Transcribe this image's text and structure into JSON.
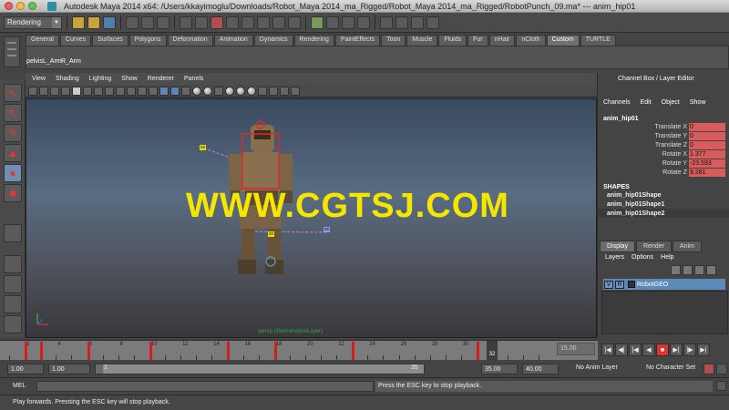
{
  "window": {
    "title": "Autodesk Maya 2014 x64: /Users/kkayimoglu/Downloads/Robot_Maya 2014_ma_Rigged/Robot_Maya 2014_ma_Rigged/RobotPunch_09.ma*   ---   anim_hip01",
    "traffic_colors": [
      "#ee5c55",
      "#f6bc3a",
      "#5ec749"
    ]
  },
  "status_line": {
    "menu_set": "Rendering"
  },
  "shelf": {
    "tabs": [
      "General",
      "Curves",
      "Surfaces",
      "Polygons",
      "Deformation",
      "Animation",
      "Dynamics",
      "Rendering",
      "PaintEffects",
      "Toon",
      "Muscle",
      "Fluids",
      "Fur",
      "nHair",
      "nCloth",
      "Custom",
      "TURTLE"
    ],
    "active_tab": "Custom",
    "items": [
      "pelvis",
      "L_Arm",
      "R_Arm"
    ]
  },
  "panel": {
    "menus": [
      "View",
      "Shading",
      "Lighting",
      "Show",
      "Renderer",
      "Panels"
    ],
    "camera_label": "persp (lifeAnimationLayer)",
    "watermark": "WWW.CGTSJ.COM",
    "control_tags": [
      "xx",
      "xx",
      "xx"
    ]
  },
  "channel_box": {
    "title": "Channel Box / Layer Editor",
    "menus": [
      "Channels",
      "Edit",
      "Object",
      "Show"
    ],
    "object": "anim_hip01",
    "attributes": [
      {
        "name": "Translate X",
        "value": "0"
      },
      {
        "name": "Translate Y",
        "value": "0"
      },
      {
        "name": "Translate Z",
        "value": "0"
      },
      {
        "name": "Rotate X",
        "value": "1.377"
      },
      {
        "name": "Rotate Y",
        "value": "-23.593"
      },
      {
        "name": "Rotate Z",
        "value": "9.281"
      }
    ],
    "shapes_header": "SHAPES",
    "shapes": [
      "anim_hip01Shape",
      "anim_hip01Shape1",
      "anim_hip01Shape2"
    ]
  },
  "layer_editor": {
    "tabs": [
      "Display",
      "Render",
      "Anim"
    ],
    "active_tab": "Display",
    "menus": [
      "Layers",
      "Options",
      "Help"
    ],
    "layers": [
      {
        "v": "V",
        "r": "R",
        "name": "RobotGEO"
      }
    ]
  },
  "time_slider": {
    "tick_labels": [
      "2",
      "4",
      "6",
      "8",
      "10",
      "12",
      "14",
      "16",
      "18",
      "20",
      "22",
      "24",
      "26",
      "28",
      "30"
    ],
    "current_frame": "32",
    "end_field": "15.00",
    "keyframes": [
      2,
      3,
      6,
      10,
      15,
      18,
      23,
      31
    ]
  },
  "range_slider": {
    "start_time": "1.00",
    "playback_start": "1.00",
    "range_left": "1",
    "range_right": "35",
    "playback_end": "35.00",
    "end_time": "40.00",
    "anim_layer": "No Anim Layer",
    "character_set": "No Character Set"
  },
  "command_line": {
    "language": "MEL",
    "result": "Press the ESC key to stop playback."
  },
  "help_line": "Play forwards. Pressing the ESC key will stop playback.",
  "colors": {
    "accent_blue": "#5d8ab6",
    "key_red": "#d21e1e",
    "attr_red": "#d95c5c",
    "watermark_yellow": "#f5e600"
  }
}
